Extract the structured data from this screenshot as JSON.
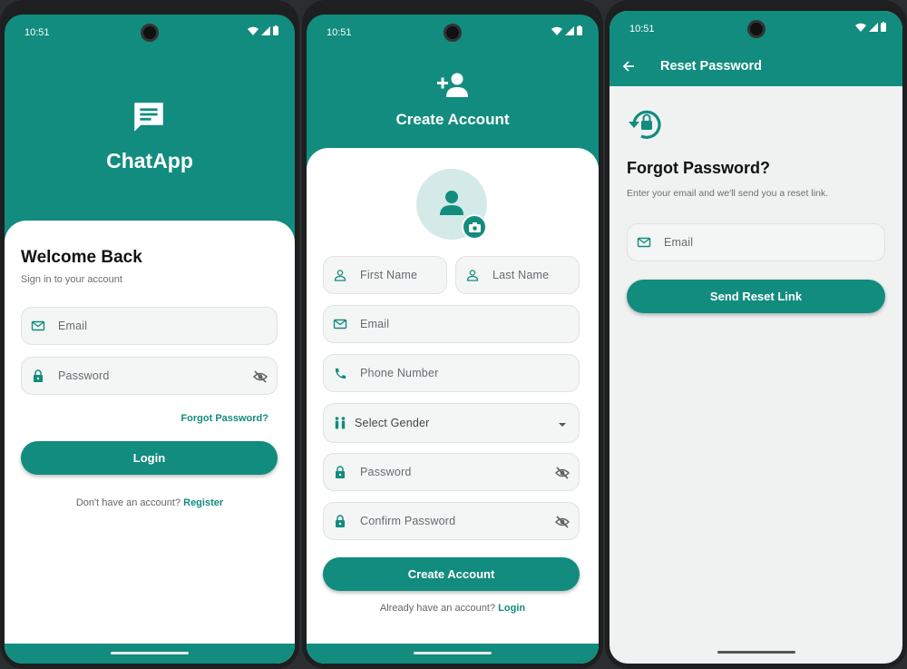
{
  "status_bar": {
    "time": "10:51"
  },
  "login": {
    "app_name": "ChatApp",
    "title": "Welcome Back",
    "subtitle": "Sign in to your account",
    "email_placeholder": "Email",
    "password_placeholder": "Password",
    "forgot_link": "Forgot Password?",
    "login_button": "Login",
    "footer_text": "Don't have an account? ",
    "footer_link": "Register"
  },
  "register": {
    "title": "Create Account",
    "first_name_placeholder": "First Name",
    "last_name_placeholder": "Last Name",
    "email_placeholder": "Email",
    "phone_placeholder": "Phone Number",
    "gender_placeholder": "Select Gender",
    "password_placeholder": "Password",
    "confirm_placeholder": "Confirm Password",
    "create_button": "Create Account",
    "footer_text": "Already have an account? ",
    "footer_link": "Login"
  },
  "reset": {
    "appbar_title": "Reset Password",
    "title": "Forgot Password?",
    "subtitle": "Enter your email and we'll send you a reset link.",
    "email_placeholder": "Email",
    "send_button": "Send Reset Link"
  },
  "colors": {
    "primary": "#128C7E",
    "background": "#F0F2F2",
    "field": "#F4F5F5"
  }
}
